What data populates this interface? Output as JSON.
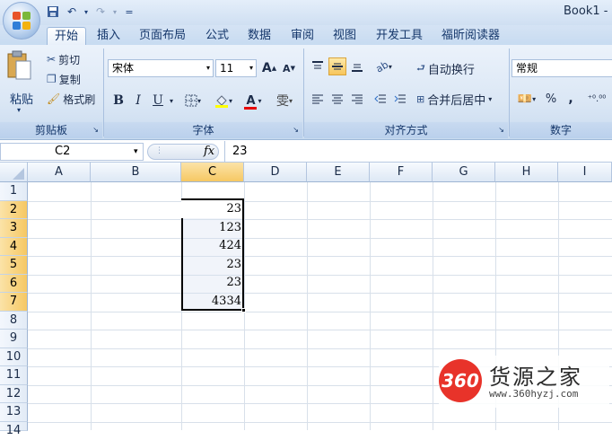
{
  "title": "Book1 -",
  "quick_access": {
    "save": "save-icon",
    "undo": "undo-icon",
    "redo": "redo-icon",
    "customize": "="
  },
  "tabs": [
    "开始",
    "插入",
    "页面布局",
    "公式",
    "数据",
    "审阅",
    "视图",
    "开发工具",
    "福昕阅读器"
  ],
  "active_tab": "开始",
  "ribbon": {
    "clipboard": {
      "paste": "粘贴",
      "cut": "剪切",
      "copy": "复制",
      "format_painter": "格式刷",
      "label": "剪贴板"
    },
    "font": {
      "name": "宋体",
      "size": "11",
      "grow": "A",
      "shrink": "A",
      "bold": "B",
      "italic": "I",
      "underline": "U",
      "label": "字体",
      "font_color_letter": "A",
      "phonetic": "雯"
    },
    "alignment": {
      "wrap": "自动换行",
      "merge": "合并后居中",
      "label": "对齐方式"
    },
    "number": {
      "format": "常规",
      "percent": "%",
      "comma": ",",
      "label": "数字"
    }
  },
  "formula_bar": {
    "name_box": "C2",
    "fx": "fx",
    "value": "23"
  },
  "columns": [
    "A",
    "B",
    "C",
    "D",
    "E",
    "F",
    "G",
    "H",
    "I"
  ],
  "rows": [
    "1",
    "2",
    "3",
    "4",
    "5",
    "6",
    "7",
    "8",
    "9",
    "10",
    "11",
    "12",
    "13",
    "14"
  ],
  "cells": {
    "C2": "23",
    "C3": "123",
    "C4": "424",
    "C5": "23",
    "C6": "23",
    "C7": "4334"
  },
  "watermark": {
    "logo": "360",
    "name": "货源之家",
    "url": "www.360hyzj.com"
  }
}
